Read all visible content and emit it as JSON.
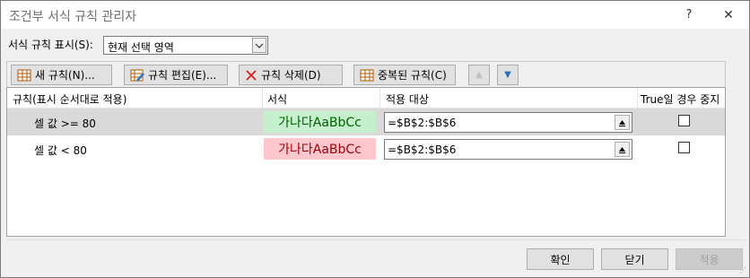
{
  "window": {
    "title": "조건부 서식 규칙 관리자",
    "help": "?",
    "close": "✕"
  },
  "show_rules": {
    "label": "서식 규칙 표시(S):",
    "selected": "현재 선택 영역"
  },
  "toolbar": {
    "new_rule": "새 규칙(N)...",
    "edit_rule": "규칙 편집(E)...",
    "delete_rule": "규칙 삭제(D)",
    "duplicate_rule": "중복된 규칙(C)",
    "move_up": "▲",
    "move_down": "▼"
  },
  "columns": {
    "rule": "규칙(표시 순서대로 적용)",
    "format": "서식",
    "applies_to": "적용 대상",
    "stop_if_true": "True일 경우 중지"
  },
  "rules": [
    {
      "rule": "셀 값 >= 80",
      "preview": "가나다AaBbCc",
      "preview_bg": "#c6efce",
      "preview_fg": "#006100",
      "applies_to": "=$B$2:$B$6",
      "stop_if_true": false,
      "selected": true
    },
    {
      "rule": "셀 값 < 80",
      "preview": "가나다AaBbCc",
      "preview_bg": "#ffc7ce",
      "preview_fg": "#9c0006",
      "applies_to": "=$B$2:$B$6",
      "stop_if_true": false,
      "selected": false
    }
  ],
  "buttons": {
    "ok": "확인",
    "close": "닫기",
    "apply": "적용"
  }
}
